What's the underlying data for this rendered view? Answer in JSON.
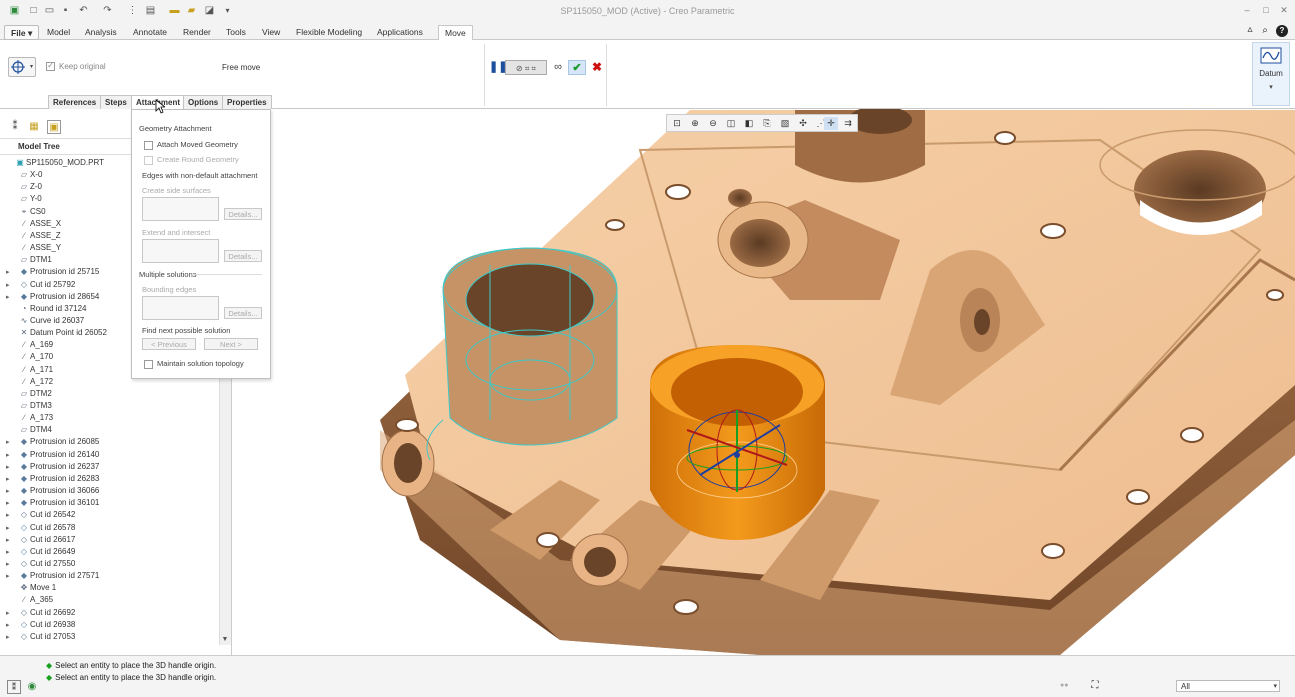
{
  "window": {
    "title": "SP115050_MOD (Active) - Creo Parametric"
  },
  "quick_access": [
    "app-icon",
    "new-icon",
    "open-icon",
    "save-icon",
    "undo-icon",
    "redo-icon",
    "regenerate-icon",
    "windows-icon",
    "folder-icon",
    "select-icon",
    "close-window-icon"
  ],
  "ribbon": {
    "file_label": "File",
    "tabs": [
      "Model",
      "Analysis",
      "Annotate",
      "Render",
      "Tools",
      "View",
      "Flexible Modeling",
      "Applications"
    ],
    "active_tab": "Move",
    "keep_original_label": "Keep original",
    "free_move_label": "Free move",
    "datum_label": "Datum"
  },
  "dashboard_tabs": [
    "References",
    "Steps",
    "Attachment",
    "Options",
    "Properties"
  ],
  "model_tree": {
    "header": "Model Tree",
    "items": [
      {
        "label": "SP115050_MOD.PRT",
        "icon": "part-icon",
        "expandable": false,
        "indent": 0
      },
      {
        "label": "X-0",
        "icon": "plane-icon",
        "expandable": false,
        "indent": 1
      },
      {
        "label": "Z-0",
        "icon": "plane-icon",
        "expandable": false,
        "indent": 1
      },
      {
        "label": "Y-0",
        "icon": "plane-icon",
        "expandable": false,
        "indent": 1
      },
      {
        "label": "CS0",
        "icon": "csys-icon",
        "expandable": false,
        "indent": 1
      },
      {
        "label": "ASSE_X",
        "icon": "axis-icon",
        "expandable": false,
        "indent": 1
      },
      {
        "label": "ASSE_Z",
        "icon": "axis-icon",
        "expandable": false,
        "indent": 1
      },
      {
        "label": "ASSE_Y",
        "icon": "axis-icon",
        "expandable": false,
        "indent": 1
      },
      {
        "label": "DTM1",
        "icon": "plane-icon",
        "expandable": false,
        "indent": 1
      },
      {
        "label": "Protrusion id 25715",
        "icon": "protrusion-icon",
        "expandable": true,
        "indent": 1
      },
      {
        "label": "Cut id 25792",
        "icon": "cut-icon",
        "expandable": true,
        "indent": 1
      },
      {
        "label": "Protrusion id 28654",
        "icon": "protrusion-icon",
        "expandable": true,
        "indent": 1
      },
      {
        "label": "Round id 37124",
        "icon": "round-icon",
        "expandable": false,
        "indent": 1
      },
      {
        "label": "Curve id 26037",
        "icon": "curve-icon",
        "expandable": false,
        "indent": 1
      },
      {
        "label": "Datum Point id 26052",
        "icon": "point-icon",
        "expandable": false,
        "indent": 1
      },
      {
        "label": "A_169",
        "icon": "axis-icon",
        "expandable": false,
        "indent": 1
      },
      {
        "label": "A_170",
        "icon": "axis-icon",
        "expandable": false,
        "indent": 1
      },
      {
        "label": "A_171",
        "icon": "axis-icon",
        "expandable": false,
        "indent": 1
      },
      {
        "label": "A_172",
        "icon": "axis-icon",
        "expandable": false,
        "indent": 1
      },
      {
        "label": "DTM2",
        "icon": "plane-icon",
        "expandable": false,
        "indent": 1
      },
      {
        "label": "DTM3",
        "icon": "plane-icon",
        "expandable": false,
        "indent": 1
      },
      {
        "label": "A_173",
        "icon": "axis-icon",
        "expandable": false,
        "indent": 1
      },
      {
        "label": "DTM4",
        "icon": "plane-icon",
        "expandable": false,
        "indent": 1
      },
      {
        "label": "Protrusion id 26085",
        "icon": "protrusion-icon",
        "expandable": true,
        "indent": 1
      },
      {
        "label": "Protrusion id 26140",
        "icon": "protrusion-icon",
        "expandable": true,
        "indent": 1
      },
      {
        "label": "Protrusion id 26237",
        "icon": "protrusion-icon",
        "expandable": true,
        "indent": 1
      },
      {
        "label": "Protrusion id 26283",
        "icon": "protrusion-icon",
        "expandable": true,
        "indent": 1
      },
      {
        "label": "Protrusion id 36066",
        "icon": "protrusion-icon",
        "expandable": true,
        "indent": 1
      },
      {
        "label": "Protrusion id 36101",
        "icon": "protrusion-icon",
        "expandable": true,
        "indent": 1
      },
      {
        "label": "Cut id 26542",
        "icon": "cut-icon",
        "expandable": true,
        "indent": 1
      },
      {
        "label": "Cut id 26578",
        "icon": "cut-icon",
        "expandable": true,
        "indent": 1
      },
      {
        "label": "Cut id 26617",
        "icon": "cut-icon",
        "expandable": true,
        "indent": 1
      },
      {
        "label": "Cut id 26649",
        "icon": "cut-icon",
        "expandable": true,
        "indent": 1
      },
      {
        "label": "Cut id 27550",
        "icon": "cut-icon",
        "expandable": true,
        "indent": 1
      },
      {
        "label": "Protrusion id 27571",
        "icon": "protrusion-icon",
        "expandable": true,
        "indent": 1
      },
      {
        "label": "Move 1",
        "icon": "move-icon",
        "expandable": false,
        "indent": 1
      },
      {
        "label": "A_365",
        "icon": "axis-icon",
        "expandable": false,
        "indent": 1
      },
      {
        "label": "Cut id 26692",
        "icon": "cut-icon",
        "expandable": true,
        "indent": 1
      },
      {
        "label": "Cut id 26938",
        "icon": "cut-icon",
        "expandable": true,
        "indent": 1
      },
      {
        "label": "Cut id 27053",
        "icon": "cut-icon",
        "expandable": true,
        "indent": 1
      }
    ]
  },
  "attachment_panel": {
    "geometry_attachment": "Geometry Attachment",
    "attach_moved_geometry": "Attach Moved Geometry",
    "create_round_geometry": "Create Round Geometry",
    "edges_non_default": "Edges with non-default attachment",
    "create_side_surfaces": "Create side surfaces",
    "extend_and_intersect": "Extend and intersect",
    "multiple_solutions": "Multiple solutions",
    "bounding_edges": "Bounding edges",
    "details_label": "Details...",
    "find_next": "Find next possible solution",
    "previous_label": "< Previous",
    "next_label": "Next >",
    "maintain_topology": "Maintain solution topology"
  },
  "status": {
    "messages": [
      "Select an entity to place the 3D handle origin.",
      "Select an entity to place the 3D handle origin."
    ],
    "filter_value": "All"
  },
  "colors": {
    "part_face": "#f2c49a",
    "part_shadow": "#8a5a36",
    "selection": "#f08a10",
    "wireframe": "#40c8c8",
    "accent_blue": "#1d4e9e"
  }
}
